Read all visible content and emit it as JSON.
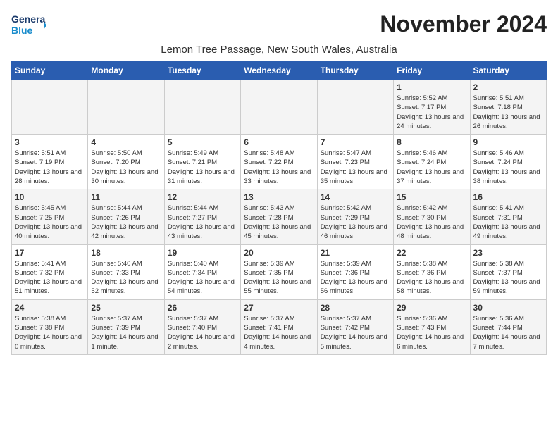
{
  "logo": {
    "line1": "General",
    "line2": "Blue"
  },
  "title": "November 2024",
  "location": "Lemon Tree Passage, New South Wales, Australia",
  "days_of_week": [
    "Sunday",
    "Monday",
    "Tuesday",
    "Wednesday",
    "Thursday",
    "Friday",
    "Saturday"
  ],
  "weeks": [
    [
      {
        "day": "",
        "info": ""
      },
      {
        "day": "",
        "info": ""
      },
      {
        "day": "",
        "info": ""
      },
      {
        "day": "",
        "info": ""
      },
      {
        "day": "",
        "info": ""
      },
      {
        "day": "1",
        "info": "Sunrise: 5:52 AM\nSunset: 7:17 PM\nDaylight: 13 hours and 24 minutes."
      },
      {
        "day": "2",
        "info": "Sunrise: 5:51 AM\nSunset: 7:18 PM\nDaylight: 13 hours and 26 minutes."
      }
    ],
    [
      {
        "day": "3",
        "info": "Sunrise: 5:51 AM\nSunset: 7:19 PM\nDaylight: 13 hours and 28 minutes."
      },
      {
        "day": "4",
        "info": "Sunrise: 5:50 AM\nSunset: 7:20 PM\nDaylight: 13 hours and 30 minutes."
      },
      {
        "day": "5",
        "info": "Sunrise: 5:49 AM\nSunset: 7:21 PM\nDaylight: 13 hours and 31 minutes."
      },
      {
        "day": "6",
        "info": "Sunrise: 5:48 AM\nSunset: 7:22 PM\nDaylight: 13 hours and 33 minutes."
      },
      {
        "day": "7",
        "info": "Sunrise: 5:47 AM\nSunset: 7:23 PM\nDaylight: 13 hours and 35 minutes."
      },
      {
        "day": "8",
        "info": "Sunrise: 5:46 AM\nSunset: 7:24 PM\nDaylight: 13 hours and 37 minutes."
      },
      {
        "day": "9",
        "info": "Sunrise: 5:46 AM\nSunset: 7:24 PM\nDaylight: 13 hours and 38 minutes."
      }
    ],
    [
      {
        "day": "10",
        "info": "Sunrise: 5:45 AM\nSunset: 7:25 PM\nDaylight: 13 hours and 40 minutes."
      },
      {
        "day": "11",
        "info": "Sunrise: 5:44 AM\nSunset: 7:26 PM\nDaylight: 13 hours and 42 minutes."
      },
      {
        "day": "12",
        "info": "Sunrise: 5:44 AM\nSunset: 7:27 PM\nDaylight: 13 hours and 43 minutes."
      },
      {
        "day": "13",
        "info": "Sunrise: 5:43 AM\nSunset: 7:28 PM\nDaylight: 13 hours and 45 minutes."
      },
      {
        "day": "14",
        "info": "Sunrise: 5:42 AM\nSunset: 7:29 PM\nDaylight: 13 hours and 46 minutes."
      },
      {
        "day": "15",
        "info": "Sunrise: 5:42 AM\nSunset: 7:30 PM\nDaylight: 13 hours and 48 minutes."
      },
      {
        "day": "16",
        "info": "Sunrise: 5:41 AM\nSunset: 7:31 PM\nDaylight: 13 hours and 49 minutes."
      }
    ],
    [
      {
        "day": "17",
        "info": "Sunrise: 5:41 AM\nSunset: 7:32 PM\nDaylight: 13 hours and 51 minutes."
      },
      {
        "day": "18",
        "info": "Sunrise: 5:40 AM\nSunset: 7:33 PM\nDaylight: 13 hours and 52 minutes."
      },
      {
        "day": "19",
        "info": "Sunrise: 5:40 AM\nSunset: 7:34 PM\nDaylight: 13 hours and 54 minutes."
      },
      {
        "day": "20",
        "info": "Sunrise: 5:39 AM\nSunset: 7:35 PM\nDaylight: 13 hours and 55 minutes."
      },
      {
        "day": "21",
        "info": "Sunrise: 5:39 AM\nSunset: 7:36 PM\nDaylight: 13 hours and 56 minutes."
      },
      {
        "day": "22",
        "info": "Sunrise: 5:38 AM\nSunset: 7:36 PM\nDaylight: 13 hours and 58 minutes."
      },
      {
        "day": "23",
        "info": "Sunrise: 5:38 AM\nSunset: 7:37 PM\nDaylight: 13 hours and 59 minutes."
      }
    ],
    [
      {
        "day": "24",
        "info": "Sunrise: 5:38 AM\nSunset: 7:38 PM\nDaylight: 14 hours and 0 minutes."
      },
      {
        "day": "25",
        "info": "Sunrise: 5:37 AM\nSunset: 7:39 PM\nDaylight: 14 hours and 1 minute."
      },
      {
        "day": "26",
        "info": "Sunrise: 5:37 AM\nSunset: 7:40 PM\nDaylight: 14 hours and 2 minutes."
      },
      {
        "day": "27",
        "info": "Sunrise: 5:37 AM\nSunset: 7:41 PM\nDaylight: 14 hours and 4 minutes."
      },
      {
        "day": "28",
        "info": "Sunrise: 5:37 AM\nSunset: 7:42 PM\nDaylight: 14 hours and 5 minutes."
      },
      {
        "day": "29",
        "info": "Sunrise: 5:36 AM\nSunset: 7:43 PM\nDaylight: 14 hours and 6 minutes."
      },
      {
        "day": "30",
        "info": "Sunrise: 5:36 AM\nSunset: 7:44 PM\nDaylight: 14 hours and 7 minutes."
      }
    ]
  ]
}
